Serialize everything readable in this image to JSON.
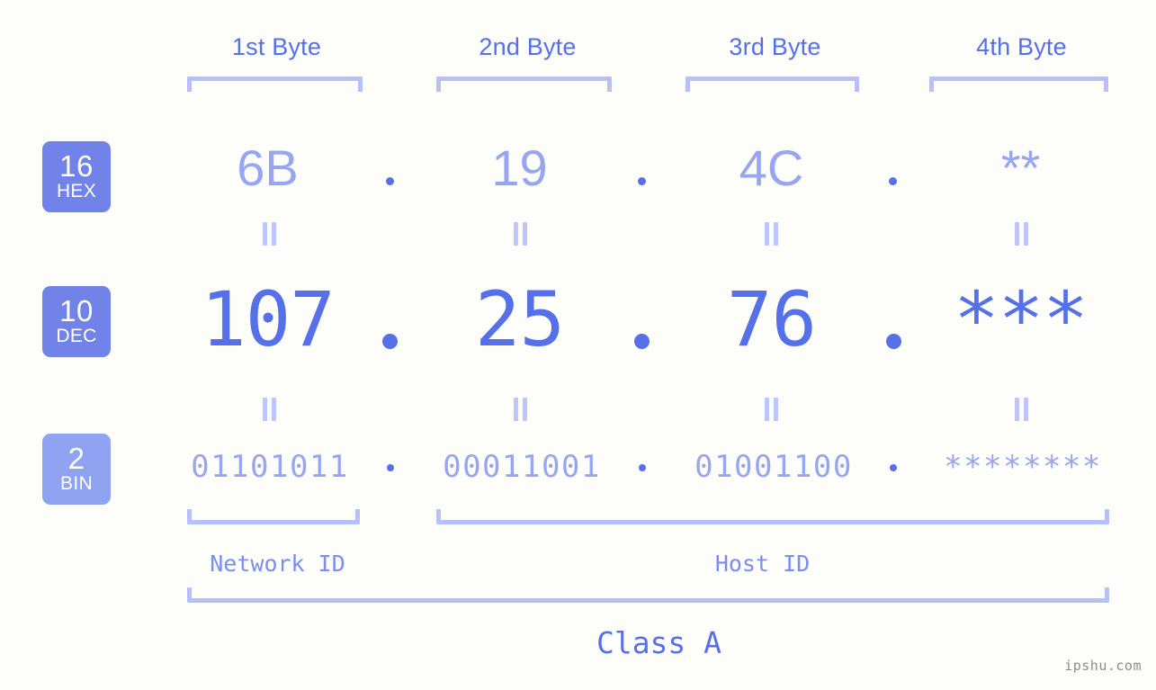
{
  "watermark": "ipshu.com",
  "byte_headers": [
    {
      "label": "1st Byte"
    },
    {
      "label": "2nd Byte"
    },
    {
      "label": "3rd Byte"
    },
    {
      "label": "4th Byte"
    }
  ],
  "rows": [
    {
      "badge_number": "16",
      "badge_name": "HEX",
      "values": [
        "6B",
        "19",
        "4C",
        "**"
      ],
      "separator": "."
    },
    {
      "badge_number": "10",
      "badge_name": "DEC",
      "values": [
        "107",
        "25",
        "76",
        "***"
      ],
      "separator": "."
    },
    {
      "badge_number": "2",
      "badge_name": "BIN",
      "values": [
        "01101011",
        "00011001",
        "01001100",
        "********"
      ],
      "separator": "."
    }
  ],
  "sections": {
    "network_id": "Network ID",
    "host_id": "Host ID",
    "class": "Class A"
  },
  "colors": {
    "background": "#fdfdfa",
    "accent_strong": "#5570e8",
    "accent_light": "#97a6f2",
    "bracket": "#b6c0fb",
    "badge_dark": "#7183e8",
    "badge_light": "#8fa3f2"
  }
}
